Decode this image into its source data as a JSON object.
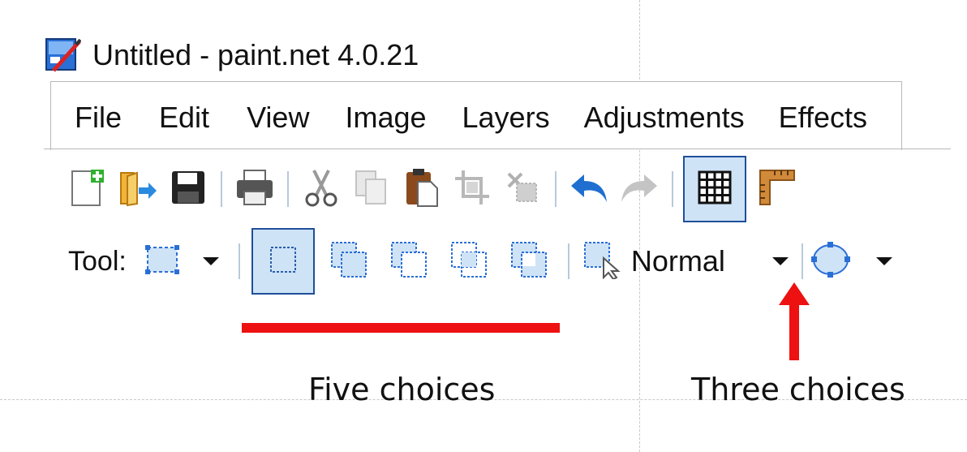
{
  "window": {
    "title": "Untitled - paint.net 4.0.21",
    "icon": "paintnet-app-icon"
  },
  "menu": {
    "items": [
      "File",
      "Edit",
      "View",
      "Image",
      "Layers",
      "Adjustments",
      "Effects"
    ]
  },
  "toolbar": {
    "buttons": [
      {
        "icon": "new-image-icon"
      },
      {
        "icon": "open-icon"
      },
      {
        "icon": "save-icon"
      },
      {
        "icon": "print-icon"
      },
      {
        "icon": "cut-icon"
      },
      {
        "icon": "copy-icon"
      },
      {
        "icon": "paste-icon"
      },
      {
        "icon": "crop-to-selection-icon"
      },
      {
        "icon": "deselect-icon"
      },
      {
        "icon": "undo-icon"
      },
      {
        "icon": "redo-icon"
      },
      {
        "icon": "grid-icon",
        "active": true
      },
      {
        "icon": "ruler-icon"
      }
    ]
  },
  "tool_options": {
    "tool_label": "Tool:",
    "current_tool_icon": "rectangle-select-icon",
    "selection_modes": [
      {
        "icon": "selection-mode-replace-icon",
        "active": true
      },
      {
        "icon": "selection-mode-union-icon"
      },
      {
        "icon": "selection-mode-exclude-icon"
      },
      {
        "icon": "selection-mode-intersect-icon"
      },
      {
        "icon": "selection-mode-xor-icon"
      }
    ],
    "selection_draw_icon": "selection-draw-mode-icon",
    "blend_mode_value": "Normal",
    "ellipse_icon": "ellipse-select-icon"
  },
  "annotations": {
    "left_caption": "Five choices",
    "right_caption": "Three choices",
    "highlight_color": "#ee1111"
  }
}
